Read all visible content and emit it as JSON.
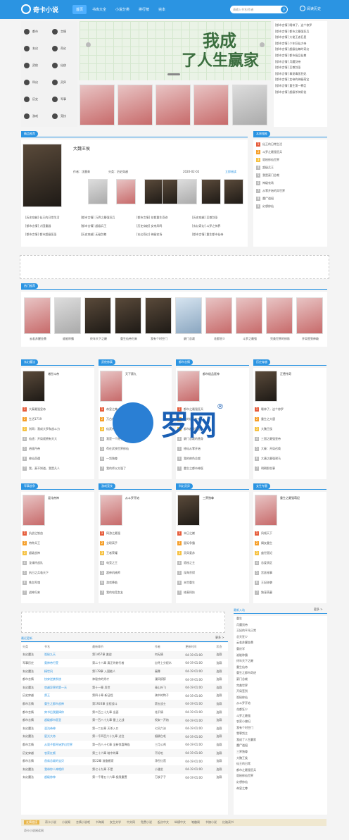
{
  "app": {
    "name": "奇卡小说"
  },
  "nav": [
    "首页",
    "书库大全",
    "小说分类",
    "排行榜",
    "完本"
  ],
  "search": {
    "placeholder": "请输入书名/作者"
  },
  "history": "阅读历史",
  "categories": [
    "都市",
    "言情",
    "玄幻",
    "奇幻",
    "武侠",
    "仙侠",
    "科幻",
    "灵异",
    "历史",
    "军事",
    "游戏",
    "竞技"
  ],
  "banner": {
    "line1": "我成",
    "line2": "了人生赢家"
  },
  "side_news": [
    "[都市言情] 睡神了，这个修罗",
    "[都市言情] 都市之最强狂兵",
    "[都市言情] 大佬王者巨星",
    "[都市言情] 少年狂仙大帝",
    "[都市言情] 超级仙尊的奇幻",
    "[都市言情] 都市极品仙尊",
    "[都市言情] 月魔剑帝",
    "[都市言情] 至尊剑圣",
    "[都市言情] 尊宠毒医狂妃",
    "[都市言情] 女帝的神级萌宝",
    "[都市言情] 重生第一罪臣",
    "[都市言情] 超级杀神奶爸"
  ],
  "featured": {
    "section": "精品推荐",
    "title": "大魏王侯",
    "author": "作者：沈墨青",
    "cat": "分类：历史穿越",
    "date": "2020-02-02",
    "read": "立即阅读",
    "links": [
      "[历史穿越] 仙王的日常生活",
      "[都市言情] 万界之最强狂兵",
      "[都市言情] 花都重生奇迹",
      "[历史穿越] 至尊剑圣",
      "[都市言情] 大国重器",
      "[都市言情] 超级兵王",
      "[历史穿越] 女帝凤鸣",
      "[玄幻奇幻] 斗罗之神界",
      "[都市言情] 都市超级医圣",
      "[历史穿越] 无敌剑尊",
      "[玄幻奇幻] 神级农场",
      "[都市言情] 重生都市仙帝"
    ]
  },
  "rank": {
    "section": "本周强推",
    "items": [
      "仙王的日常生活",
      "斗罗之最强狂兵",
      "诡秘修仙世界",
      "超级兵王",
      "我是豪门总裁",
      "神级农场",
      "从零开始的异世界",
      "魔尸道祖",
      "幻想修仙"
    ]
  },
  "hot": {
    "section": "热门推荐",
    "titles": [
      "云若苏醒金鼎",
      "谁能称霸",
      "终年天下之巅",
      "重生仙帝归来",
      "我有个时空门",
      "豪门总裁",
      "花都狂少",
      "斗罗之最强",
      "完美世界的修炼",
      "开局签到神级"
    ]
  },
  "blocks": [
    {
      "section": "玄幻魔法",
      "title": "诸世斗帝",
      "rows": [
        "大秦最强皇帝",
        "生活1719",
        "剑网：我成大罗和战斗力",
        "仙途：开局就拥有天大",
        "逍遥丹帝",
        "修仙奇遇",
        "我，真不知道，我是凡人"
      ]
    },
    {
      "section": "武侠修真",
      "title": "天下第九",
      "rows": [
        "帝皇之尊",
        "万古神帝",
        "仙武帝尊",
        "我是一个隐士",
        "苟在武侠世界修仙",
        "一剑独尊",
        "我的师父太强了"
      ]
    },
    {
      "section": "都市言情",
      "title": "都市极品医神",
      "rows": [
        "都市之最强狂兵",
        "我的极品女神",
        "都市超级医圣",
        "豪门总裁的替身",
        "修仙从零开始",
        "我的绝色总裁",
        "重生之都市神医"
      ]
    },
    {
      "section": "历史穿越",
      "title": "正德传奇",
      "rows": [
        "睡神了，这个修罗",
        "重生之大唐",
        "大魏王侯",
        "三国之最强皇帝",
        "大秦：开局召唤",
        "大唐之最强驸马",
        "明朝那些事"
      ]
    },
    {
      "section": "军事战争",
      "title": "混沌帝神",
      "rows": [
        "抗战之铁血",
        "特种兵王",
        "超级战神",
        "龙魂特战队",
        "抗日之兵临天下",
        "铁血军魂",
        "战神归来"
      ]
    },
    {
      "section": "游戏竞技",
      "title": "从斗罗开始",
      "rows": [
        "网游之最强",
        "全职高手",
        "王者荣耀",
        "电竞之王",
        "超神机械师",
        "游戏降临",
        "我的电竞女友"
      ]
    },
    {
      "section": "科幻灵异",
      "title": "三界独尊",
      "rows": [
        "末日之巅",
        "星际争霸",
        "灵异复苏",
        "诡秘之主",
        "深海余烬",
        "末世重生",
        "修真科技"
      ]
    },
    {
      "section": "女生专题",
      "title": "重生之最强萌妃",
      "rows": [
        "凤倾天下",
        "嫡女重生",
        "盛世医妃",
        "恋爱禁区",
        "宫廷秘事",
        "王妃逆袭",
        "独宠萌妻"
      ]
    }
  ],
  "latest": {
    "section": "最近更新",
    "more": "更多 >",
    "headers": [
      "分类",
      "书名",
      "最新章节",
      "作者",
      "更新时间",
      "状态"
    ],
    "rows": [
      [
        "玄幻魔法",
        "诡秘九天",
        "第1467章 激战",
        "何无情",
        "04-19 01:00",
        "连载"
      ],
      [
        "军事历史",
        "奥神帝行受",
        "第二十八章 真正的修行者",
        "自寻上分程木",
        "04-19 01:00",
        "连载"
      ],
      [
        "玄幻魔法",
        "精世风",
        "第178章 入国能人",
        "秦舞",
        "04-19 01:00",
        "连载"
      ],
      [
        "都市言情",
        "快穿逆袭系统",
        "神秘宗的秀才",
        "漫风醉醉",
        "04-19 01:00",
        "连载"
      ],
      [
        "玄幻魔法",
        "穿越异界的第一天",
        "第十一章 异世",
        "青山外飞",
        "04-19 01:00",
        "连载"
      ],
      [
        "历史穿越",
        "赘王",
        "第四十章 新征程",
        "骑书的鸭子",
        "04-19 01:00",
        "连载"
      ],
      [
        "都市言情",
        "重生之都市战神",
        "第1924章 全程战斗",
        "第五战士",
        "04-19 01:00",
        "连载"
      ],
      [
        "都市言情",
        "穿书后我要捧你",
        "第二百三十九章 出面",
        "花不情",
        "04-19 01:00",
        "连载"
      ],
      [
        "都市言情",
        "超级都市医圣",
        "第一百八十九章 雷上之战",
        "祝安一开始",
        "04-19 01:00",
        "连载"
      ],
      [
        "玄幻魔法",
        "混沌帝神",
        "第一二五章 灭杀入口",
        "七风六沫",
        "04-19 01:00",
        "连载"
      ],
      [
        "玄幻魔法",
        "星光大帝",
        "第一千四百六十九章 过往",
        "烟柳白毛",
        "04-19 01:00",
        "连载"
      ],
      [
        "都市言情",
        "从契子都开始梦幻世界",
        "第一百八十七章 全新惊喜降临",
        "三月公鸡",
        "04-19 01:00",
        "连载"
      ],
      [
        "历史穿越",
        "农家红颜",
        "第三十六章 暗中的事",
        "不好吃",
        "04-19 01:00",
        "连载"
      ],
      [
        "都市言情",
        "首席总裁的宝贝",
        "第22章 准备搬家",
        "净世红莲",
        "04-19 01:00",
        "连载"
      ],
      [
        "玄幻魔法",
        "我带你人神相伴",
        "第七十九章 不是",
        "小潘艺",
        "04-19 01:00",
        "连载"
      ],
      [
        "玄幻魔法",
        "超级修神",
        "第一千零五十六章 极限重置",
        "万俟子子",
        "04-19 01:00",
        "连载"
      ]
    ]
  },
  "newbooks": {
    "section": "最新入站",
    "more": "更多 >",
    "items": [
      "重生",
      "月魔剑帝",
      "王妃的平凡日常",
      "总天狂少",
      "云若苏醒金鼎",
      "重庆学",
      "谁能称霸",
      "终年天下之巅",
      "重生仙帝",
      "重生之都市奇迹",
      "豪门总裁",
      "完美世界",
      "开局签到",
      "诡秘修仙",
      "从斗罗开始",
      "花都狂少",
      "斗罗之最强",
      "农家小媳妇",
      "我有个时空门",
      "雪寒剑主",
      "我成了人生赢家",
      "魔尸道祖",
      "三界独尊",
      "大魏王侯",
      "仙王的日常",
      "都市之最强狂兵",
      "诡秘修仙世界",
      "幻想修仙",
      "帝皇之尊"
    ]
  },
  "footer": {
    "label": "友情链接",
    "links": [
      "奇卡小说",
      "小说阁",
      "言情小说吧",
      "书海阁",
      "女生文学",
      "中文网",
      "免费小说",
      "起点中文",
      "纵横中文",
      "笔趣阁",
      "书旗小说",
      "红袖读书"
    ],
    "copy": "奇卡小说阅读网"
  },
  "watermark": {
    "text": "罗网",
    "reg": "®"
  }
}
